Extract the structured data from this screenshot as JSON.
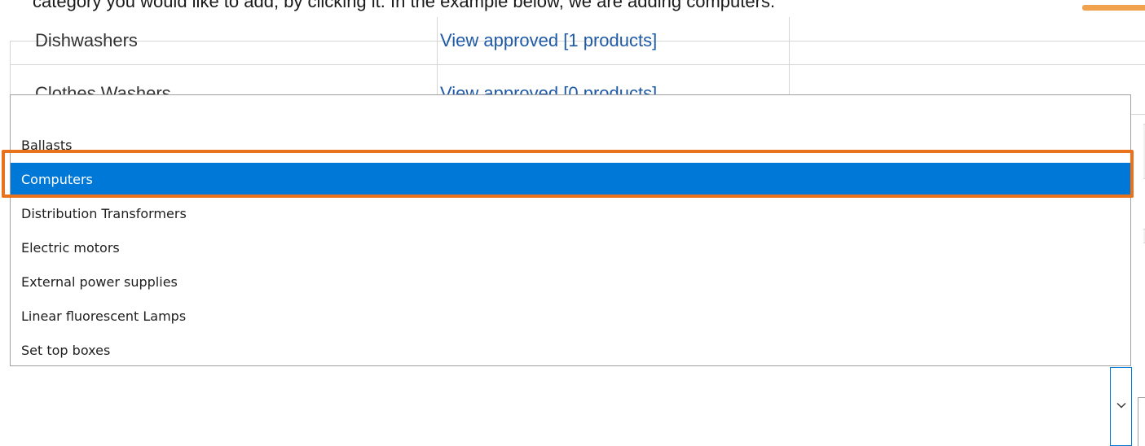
{
  "instruction_text": "category you would like to add, by clicking it. In the example below, we are adding computers.",
  "background_table": {
    "rows": [
      {
        "name": "Dishwashers",
        "link": "View approved [1   products]"
      },
      {
        "name": "Clothes Washers",
        "link": "View approved [0   products]"
      }
    ]
  },
  "dropdown": {
    "options": [
      {
        "label": ""
      },
      {
        "label": "Ballasts"
      },
      {
        "label": "Computers",
        "selected": true
      },
      {
        "label": "Distribution Transformers"
      },
      {
        "label": "Electric motors"
      },
      {
        "label": "External power supplies"
      },
      {
        "label": "Linear fluorescent Lamps"
      },
      {
        "label": "Set top boxes"
      }
    ],
    "selected_label": "Computers"
  },
  "colors": {
    "selected_background": "#0078d7",
    "highlight_border": "#e8731c",
    "link": "#1f5aa6",
    "accent": "#f0a24f"
  },
  "icons": {
    "dropdown_arrow": "chevron-down-icon"
  }
}
